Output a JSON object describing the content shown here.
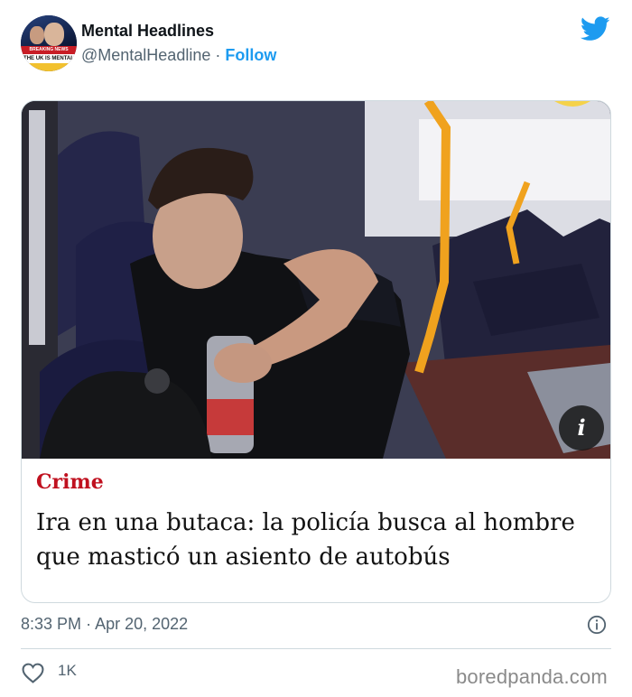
{
  "header": {
    "display_name": "Mental Headlines",
    "handle": "@MentalHeadline",
    "separator": "·",
    "follow_label": "Follow",
    "avatar_text": "THE UK IS MENTAL",
    "avatar_badge": "BREAKING NEWS"
  },
  "card": {
    "section": "Crime",
    "headline": "Ira en una butaca: la policía busca al hombre que masticó un asiento de autobús",
    "info_label": "i"
  },
  "footer": {
    "time": "8:33 PM",
    "separator": "·",
    "date": "Apr 20, 2022",
    "like_count": "1K",
    "watermark": "boredpanda.com"
  },
  "icons": {
    "brand": "twitter-bird-icon",
    "info": "info-circle-icon",
    "like": "heart-icon"
  },
  "colors": {
    "twitter_blue": "#1d9bf0",
    "section_red": "#c0111f",
    "muted_text": "#536471",
    "border": "#cfd9de"
  }
}
